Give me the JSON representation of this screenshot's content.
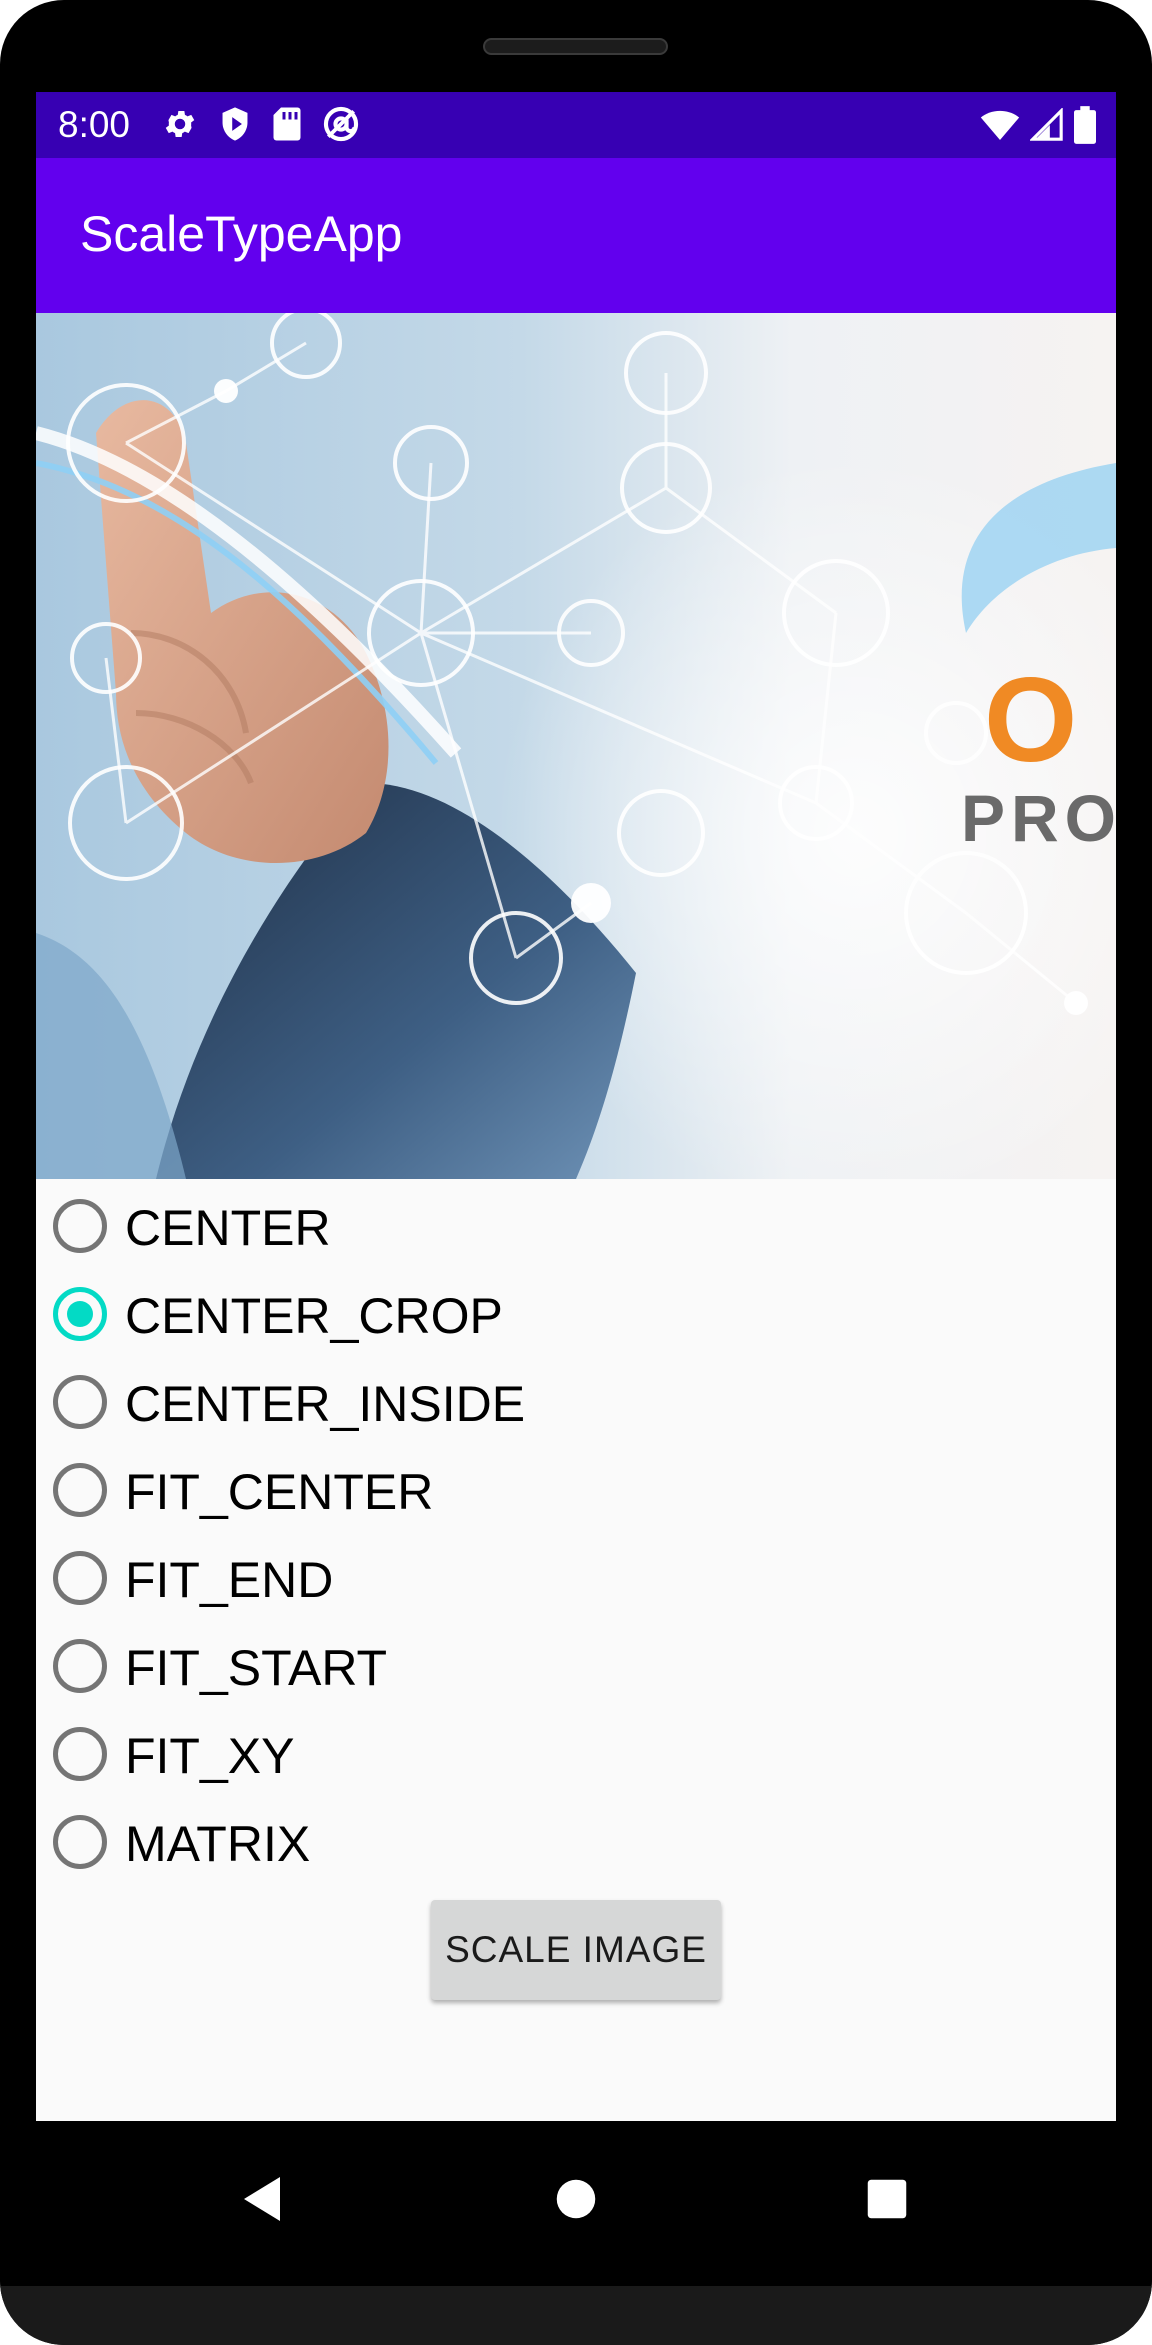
{
  "status_bar": {
    "time": "8:00",
    "left_icons": [
      "gear-icon",
      "shield-play-icon",
      "sd-card-icon",
      "at-sign-icon"
    ],
    "right_icons": [
      "wifi-icon",
      "cell-signal-icon",
      "battery-icon"
    ]
  },
  "app_bar": {
    "title": "ScaleTypeApp"
  },
  "hero_image": {
    "logo_text_1": "O",
    "logo_text_2": "PRO",
    "accent_color": "#f08a24"
  },
  "scale_types": {
    "selected": "CENTER_CROP",
    "options": [
      {
        "label": "CENTER",
        "checked": false
      },
      {
        "label": "CENTER_CROP",
        "checked": true
      },
      {
        "label": "CENTER_INSIDE",
        "checked": false
      },
      {
        "label": "FIT_CENTER",
        "checked": false
      },
      {
        "label": "FIT_END",
        "checked": false
      },
      {
        "label": "FIT_START",
        "checked": false
      },
      {
        "label": "FIT_XY",
        "checked": false
      },
      {
        "label": "MATRIX",
        "checked": false
      }
    ]
  },
  "action": {
    "button_label": "SCALE IMAGE"
  },
  "nav_bar": {
    "buttons": [
      "back-icon",
      "home-icon",
      "recents-icon"
    ]
  },
  "colors": {
    "status_bar": "#3700b3",
    "app_bar": "#6200ee",
    "radio_checked": "#03dac5",
    "radio_unchecked": "#757575",
    "button_bg": "#d6d7d7"
  }
}
